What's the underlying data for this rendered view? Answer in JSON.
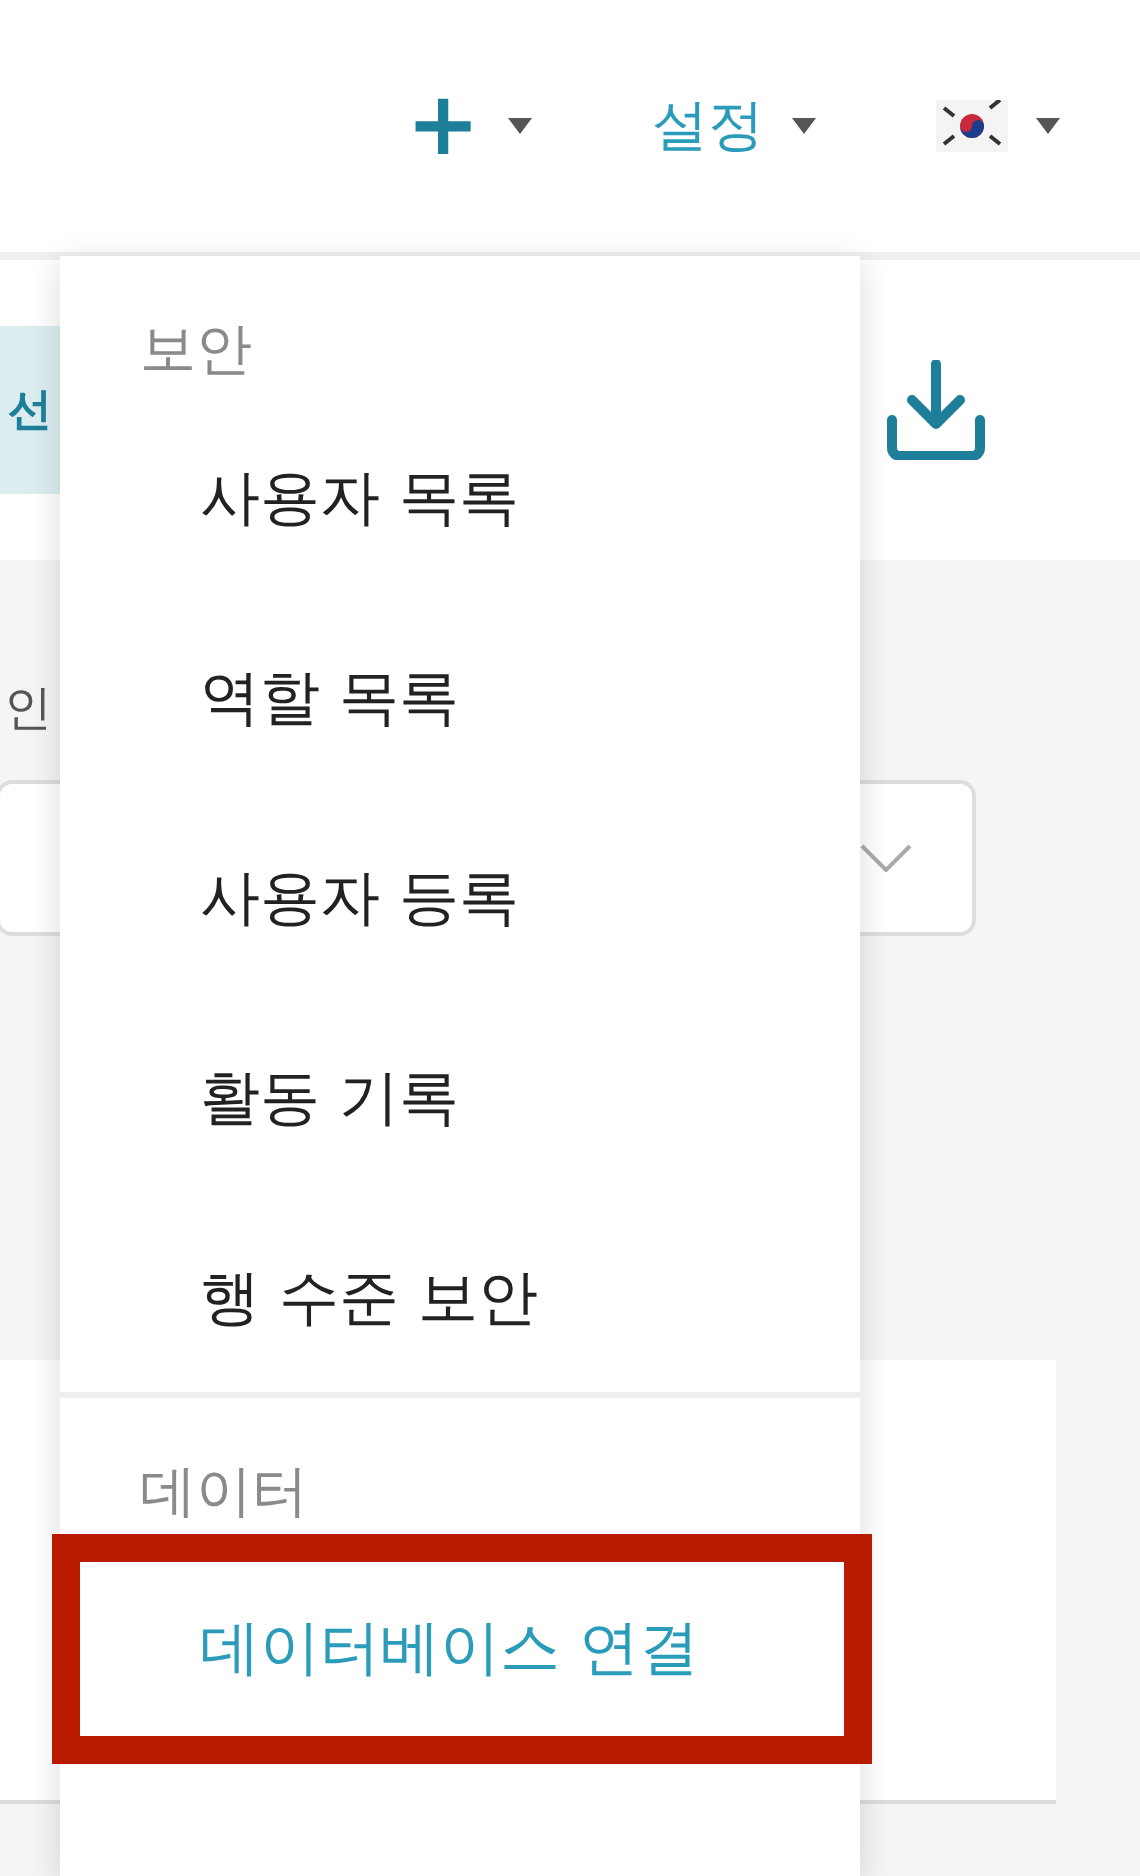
{
  "header": {
    "nav": [
      {
        "kind": "plus",
        "label": "+"
      },
      {
        "kind": "text",
        "label": "설정"
      },
      {
        "kind": "flag"
      }
    ]
  },
  "toolbar": {
    "button_fragment": "선"
  },
  "form": {
    "label_fragment": "인"
  },
  "menu": {
    "sections": [
      {
        "title": "보안",
        "items": [
          {
            "label": "사용자 목록",
            "selected": false
          },
          {
            "label": "역할 목록",
            "selected": false
          },
          {
            "label": "사용자 등록",
            "selected": false
          },
          {
            "label": "활동 기록",
            "selected": false
          },
          {
            "label": "행 수준 보안",
            "selected": false
          }
        ]
      },
      {
        "title": "데이터",
        "items": [
          {
            "label": "데이터베이스 연결",
            "selected": true
          }
        ]
      }
    ]
  }
}
